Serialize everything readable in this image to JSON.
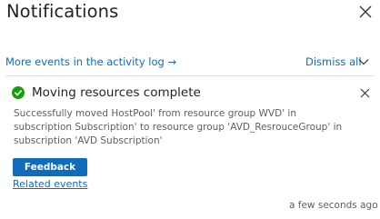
{
  "panel": {
    "title": "Notifications",
    "close_icon": "close-icon"
  },
  "toolbar": {
    "activity_log_link": "More events in the activity log →",
    "dismiss_label": "Dismiss all",
    "dismiss_icon": "chevron-down-icon"
  },
  "notification": {
    "status_icon": "success-check-icon",
    "status_color": "#13a10e",
    "title": "Moving resources complete",
    "close_icon": "close-icon",
    "message_lines": [
      "Successfully moved                    HostPool' from resource group          WVD' in",
      "subscription            Subscription' to resource group 'AVD_ResrouceGroup' in",
      "subscription 'AVD Subscription'"
    ],
    "feedback_label": "Feedback",
    "related_link": "Related events",
    "timestamp": "a few seconds ago"
  },
  "colors": {
    "link": "#0f6cbd",
    "button_bg": "#0f6cbd",
    "text": "#323130",
    "muted_text": "#605e5c",
    "divider": "#e1dfdd"
  }
}
